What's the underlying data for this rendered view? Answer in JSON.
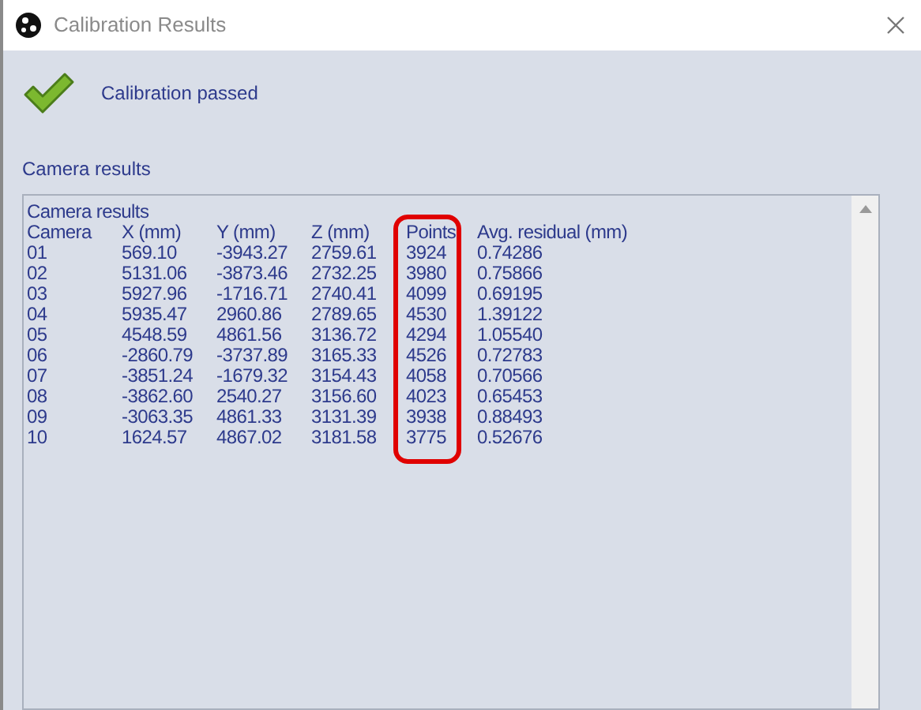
{
  "window": {
    "title": "Calibration Results"
  },
  "status": {
    "passed": true,
    "message": "Calibration passed"
  },
  "section_label": "Camera results",
  "results": {
    "heading": "Camera results",
    "columns": [
      {
        "header": "Camera",
        "highlighted": false,
        "cells": [
          "01",
          "02",
          "03",
          "04",
          "05",
          "06",
          "07",
          "08",
          "09",
          "10"
        ]
      },
      {
        "header": "X (mm)",
        "highlighted": false,
        "cells": [
          "569.10",
          "5131.06",
          "5927.96",
          "5935.47",
          "4548.59",
          "-2860.79",
          "-3851.24",
          "-3862.60",
          "-3063.35",
          "1624.57"
        ]
      },
      {
        "header": "Y (mm)",
        "highlighted": false,
        "cells": [
          "-3943.27",
          "-3873.46",
          "-1716.71",
          "2960.86",
          "4861.56",
          "-3737.89",
          "-1679.32",
          "2540.27",
          "4861.33",
          "4867.02"
        ]
      },
      {
        "header": "Z (mm)",
        "highlighted": false,
        "cells": [
          "2759.61",
          "2732.25",
          "2740.41",
          "2789.65",
          "3136.72",
          "3165.33",
          "3154.43",
          "3156.60",
          "3131.39",
          "3181.58"
        ]
      },
      {
        "header": "Points",
        "highlighted": true,
        "cells": [
          "3924",
          "3980",
          "4099",
          "4530",
          "4294",
          "4526",
          "4058",
          "4023",
          "3938",
          "3775"
        ]
      },
      {
        "header": "Avg. residual (mm)",
        "highlighted": false,
        "cells": [
          "0.74286",
          "0.75866",
          "0.69195",
          "1.39122",
          "1.05540",
          "0.72783",
          "0.70566",
          "0.65453",
          "0.88493",
          "0.52676"
        ]
      }
    ]
  }
}
